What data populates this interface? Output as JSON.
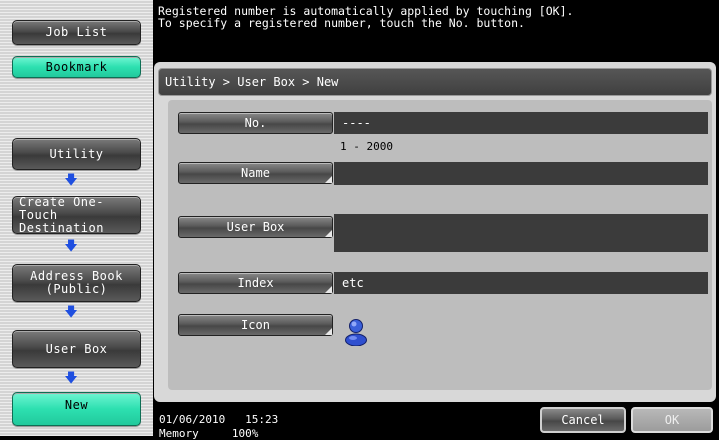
{
  "left_nav": {
    "job_list": "Job List",
    "bookmark": "Bookmark",
    "utility": "Utility",
    "create_one_touch_line1": "Create One-Touch",
    "create_one_touch_line2": "Destination",
    "address_book_line1": "Address Book",
    "address_book_line2": "(Public)",
    "user_box": "User Box",
    "new": "New"
  },
  "message": {
    "line1": "Registered number is automatically applied by touching [OK].",
    "line2": "To specify a registered number, touch the No. button."
  },
  "breadcrumb": "Utility > User Box > New",
  "fields": {
    "no_label": "No.",
    "no_value": "----",
    "no_range": "1 - 2000",
    "name_label": "Name",
    "name_value": "",
    "userbox_label": "User Box",
    "userbox_value": "",
    "index_label": "Index",
    "index_value": "etc",
    "icon_label": "Icon"
  },
  "status": {
    "date": "01/06/2010",
    "time": "15:23",
    "memory_label": "Memory",
    "memory_value": "100%"
  },
  "actions": {
    "cancel": "Cancel",
    "ok": "OK"
  },
  "colors": {
    "accent_green": "#2de0b0",
    "arrow_blue": "#1f4fe0",
    "icon_blue": "#3a5fd9"
  }
}
